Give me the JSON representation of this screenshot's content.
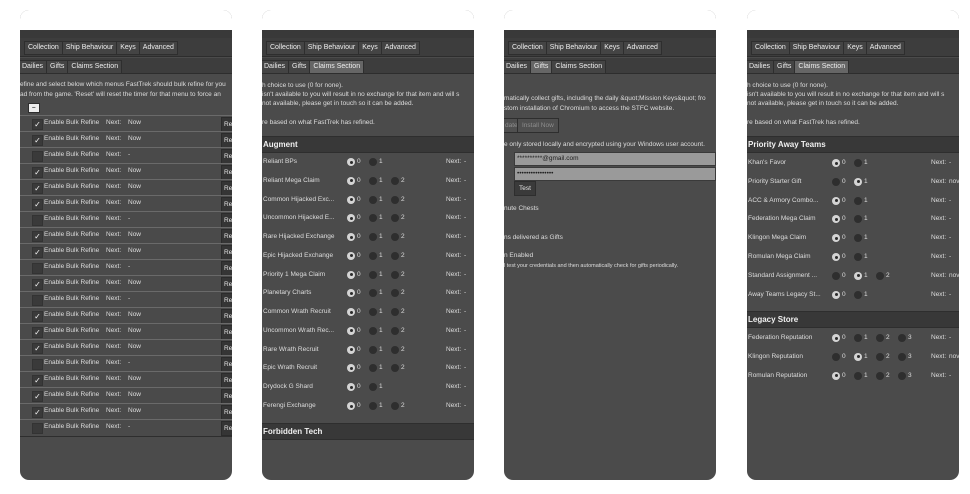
{
  "tabs_main": [
    "Collection",
    "Ship Behaviour",
    "Keys",
    "Advanced"
  ],
  "tabs_sub": [
    "Dailies",
    "Gifts",
    "Claims Section"
  ],
  "panel1": {
    "desc": [
      "efine and select below which menus FastTrek should bulk refine for you",
      "ad from the game. 'Reset' will reset the timer for that menu to force an"
    ],
    "minus_label": "–",
    "row_label": "Enable Bulk Refine",
    "next_label": "Next:",
    "reset_label": "Res",
    "check_glyph": "✓",
    "rows": [
      {
        "checked": true,
        "next": "Now"
      },
      {
        "checked": true,
        "next": "Now"
      },
      {
        "checked": false,
        "next": "-"
      },
      {
        "checked": true,
        "next": "Now"
      },
      {
        "checked": true,
        "next": "Now"
      },
      {
        "checked": true,
        "next": "Now"
      },
      {
        "checked": false,
        "next": "-"
      },
      {
        "checked": true,
        "next": "Now"
      },
      {
        "checked": true,
        "next": "Now"
      },
      {
        "checked": false,
        "next": "-"
      },
      {
        "checked": true,
        "next": "Now"
      },
      {
        "checked": false,
        "next": "-"
      },
      {
        "checked": true,
        "next": "Now"
      },
      {
        "checked": true,
        "next": "Now"
      },
      {
        "checked": true,
        "next": "Now"
      },
      {
        "checked": false,
        "next": "-"
      },
      {
        "checked": true,
        "next": "Now"
      },
      {
        "checked": true,
        "next": "Now"
      },
      {
        "checked": true,
        "next": "Now"
      },
      {
        "checked": false,
        "next": "-"
      }
    ]
  },
  "panel2": {
    "desc": [
      "h choice to use (0 for none).",
      "isn't available to you will result in no exchange for that item and will s",
      "not available, please get in touch so it can be added.",
      "re based on what FastTrek has refined."
    ],
    "section": "Augment",
    "section2": "Forbidden Tech",
    "next_label": "Next:",
    "rows": [
      {
        "label": "Reliant BPs",
        "options": [
          "0",
          "1"
        ],
        "selected": 0,
        "next": "-"
      },
      {
        "label": "Reliant Mega Claim",
        "options": [
          "0",
          "1",
          "2"
        ],
        "selected": 0,
        "next": "-"
      },
      {
        "label": "Common Hijacked Exc...",
        "options": [
          "0",
          "1",
          "2"
        ],
        "selected": 0,
        "next": "-"
      },
      {
        "label": "Uncommon Hijacked E...",
        "options": [
          "0",
          "1",
          "2"
        ],
        "selected": 0,
        "next": "-"
      },
      {
        "label": "Rare Hijacked Exchange",
        "options": [
          "0",
          "1",
          "2"
        ],
        "selected": 0,
        "next": "-"
      },
      {
        "label": "Epic Hijacked Exchange",
        "options": [
          "0",
          "1",
          "2"
        ],
        "selected": 0,
        "next": "-"
      },
      {
        "label": "Priority 1 Mega Claim",
        "options": [
          "0",
          "1",
          "2"
        ],
        "selected": 0,
        "next": "-"
      },
      {
        "label": "Planetary Charts",
        "options": [
          "0",
          "1",
          "2"
        ],
        "selected": 0,
        "next": "-"
      },
      {
        "label": "Common Wrath Recruit",
        "options": [
          "0",
          "1",
          "2"
        ],
        "selected": 0,
        "next": "-"
      },
      {
        "label": "Uncommon Wrath Rec...",
        "options": [
          "0",
          "1",
          "2"
        ],
        "selected": 0,
        "next": "-"
      },
      {
        "label": "Rare Wrath Recruit",
        "options": [
          "0",
          "1",
          "2"
        ],
        "selected": 0,
        "next": "-"
      },
      {
        "label": "Epic Wrath Recruit",
        "options": [
          "0",
          "1",
          "2"
        ],
        "selected": 0,
        "next": "-"
      },
      {
        "label": "Drydock G Shard",
        "options": [
          "0",
          "1"
        ],
        "selected": 0,
        "next": "-"
      },
      {
        "label": "Ferengi Exchange",
        "options": [
          "0",
          "1",
          "2"
        ],
        "selected": 0,
        "next": "-"
      }
    ]
  },
  "panel3": {
    "desc": [
      "matically collect gifts, including the daily &quot;Mission Keys&quot; fro",
      "stom installation of Chromium to access the STFC website."
    ],
    "update_btn": "date",
    "install_btn": "Install Now",
    "stored_text": "e only stored locally and encrypted using your Windows user account.",
    "email_value": "**********@gmail.com",
    "password_value": "••••••••••••••••",
    "test_btn": "Test",
    "chests_text": "nute Chests",
    "delivered_text": "ns delivered as Gifts",
    "enabled_text": "n Enabled",
    "note_text": "l test your credentials and then automatically check for gifts periodically."
  },
  "panel4": {
    "desc": [
      "h choice to use (0 for none).",
      "isn't available to you will result in no exchange for that item and will s",
      "not available, please get in touch so it can be added.",
      "re based on what FastTrek has refined."
    ],
    "section1": "Priority Away Teams",
    "section2": "Legacy Store",
    "next_label": "Next:",
    "rows1": [
      {
        "label": "Khan's Favor",
        "options": [
          "0",
          "1"
        ],
        "selected": 0,
        "next": "-"
      },
      {
        "label": "Priority Starter Gift",
        "options": [
          "0",
          "1"
        ],
        "selected": 1,
        "next": "nov"
      },
      {
        "label": "ACC & Armory Combo...",
        "options": [
          "0",
          "1"
        ],
        "selected": 0,
        "next": "-"
      },
      {
        "label": "Federation Mega Claim",
        "options": [
          "0",
          "1"
        ],
        "selected": 0,
        "next": "-"
      },
      {
        "label": "Klingon Mega Claim",
        "options": [
          "0",
          "1"
        ],
        "selected": 0,
        "next": "-"
      },
      {
        "label": "Romulan Mega Claim",
        "options": [
          "0",
          "1"
        ],
        "selected": 0,
        "next": "-"
      },
      {
        "label": "Standard Assignment ...",
        "options": [
          "0",
          "1",
          "2"
        ],
        "selected": 1,
        "next": "nov"
      },
      {
        "label": "Away Teams Legacy St...",
        "options": [
          "0",
          "1"
        ],
        "selected": 0,
        "next": "-"
      }
    ],
    "rows2": [
      {
        "label": "Federation Reputation",
        "options": [
          "0",
          "1",
          "2",
          "3"
        ],
        "selected": 0,
        "next": "-"
      },
      {
        "label": "Klingon Reputation",
        "options": [
          "0",
          "1",
          "2",
          "3"
        ],
        "selected": 1,
        "next": "nov"
      },
      {
        "label": "Romulan Reputation",
        "options": [
          "0",
          "1",
          "2",
          "3"
        ],
        "selected": 0,
        "next": "-"
      }
    ]
  }
}
